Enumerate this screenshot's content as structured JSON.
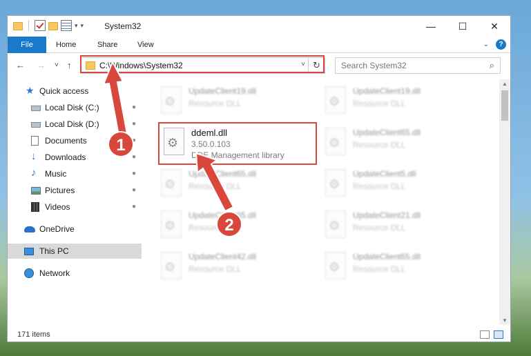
{
  "window": {
    "title": "System32",
    "controls": {
      "minimize": "—",
      "maximize": "☐",
      "close": "✕"
    }
  },
  "ribbon": {
    "tabs": [
      "File",
      "Home",
      "Share",
      "View"
    ],
    "expand_icon": "chevron-down-icon",
    "help_label": "?"
  },
  "navbar": {
    "back": "←",
    "forward": "→",
    "recent": "˅",
    "up": "↑",
    "address_path": "C:\\Windows\\System32",
    "address_dropdown": "˅",
    "refresh": "↻",
    "search_placeholder": "Search System32",
    "search_icon": "⌕"
  },
  "sidebar": {
    "items": [
      {
        "label": "Quick access",
        "icon": "star-icon",
        "pinned": false
      },
      {
        "label": "Local Disk (C:)",
        "icon": "drive-icon",
        "pinned": true
      },
      {
        "label": "Local Disk (D:)",
        "icon": "drive-icon",
        "pinned": true
      },
      {
        "label": "Documents",
        "icon": "documents-icon",
        "pinned": true
      },
      {
        "label": "Downloads",
        "icon": "downloads-icon",
        "pinned": true
      },
      {
        "label": "Music",
        "icon": "music-icon",
        "pinned": true
      },
      {
        "label": "Pictures",
        "icon": "pictures-icon",
        "pinned": true
      },
      {
        "label": "Videos",
        "icon": "videos-icon",
        "pinned": true
      },
      {
        "label": "OneDrive",
        "icon": "onedrive-icon",
        "pinned": false
      },
      {
        "label": "This PC",
        "icon": "this-pc-icon",
        "pinned": false,
        "selected": true
      },
      {
        "label": "Network",
        "icon": "network-icon",
        "pinned": false
      }
    ],
    "pin_glyph": "📌"
  },
  "files": [
    {
      "name": "UpdateClient19.dll",
      "meta": "Resource DLL",
      "blurred": true
    },
    {
      "name": "UpdateClient19.dll",
      "meta": "Resource DLL",
      "blurred": true
    },
    {
      "name": "ddeml.dll",
      "version": "3.50.0.103",
      "meta": "DDE Management library",
      "blurred": false
    },
    {
      "name": "UpdateClient65.dll",
      "meta": "Resource DLL",
      "blurred": true
    },
    {
      "name": "UpdateClient65.dll",
      "meta": "Resource DLL",
      "blurred": true
    },
    {
      "name": "UpdateClient5.dll",
      "meta": "Resource DLL",
      "blurred": true
    },
    {
      "name": "UpdateClient65.dll",
      "meta": "Resource DLL",
      "blurred": true
    },
    {
      "name": "UpdateClient21.dll",
      "meta": "Resource DLL",
      "blurred": true
    },
    {
      "name": "UpdateClient42.dll",
      "meta": "Resource DLL",
      "blurred": true
    },
    {
      "name": "UpdateClient65.dll",
      "meta": "Resource DLL",
      "blurred": true
    }
  ],
  "status": {
    "item_count": "171 items"
  },
  "annotations": {
    "badge1": "1",
    "badge2": "2",
    "color": "#d9463b"
  }
}
